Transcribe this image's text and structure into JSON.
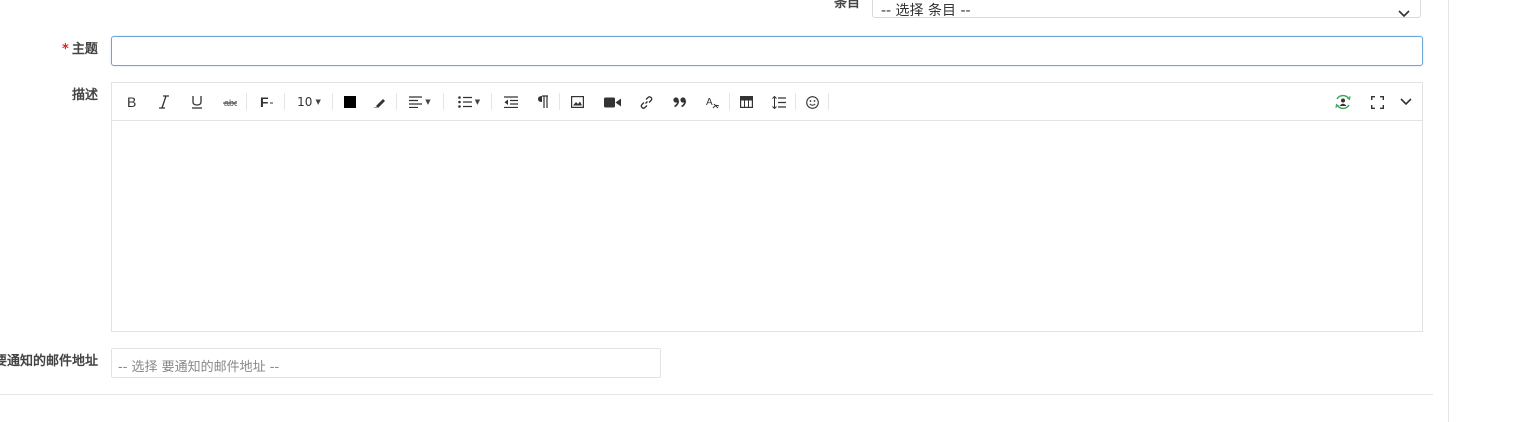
{
  "category": {
    "label": "条目",
    "placeholder": "-- 选择 条目 --"
  },
  "subject": {
    "required_mark": "*",
    "label": "主题",
    "value": ""
  },
  "description": {
    "label": "描述",
    "toolbar": {
      "font_size": "10",
      "icons": [
        "bold-icon",
        "italic-icon",
        "underline-icon",
        "strikethrough-icon",
        "font-family-icon",
        "font-size-dropdown",
        "text-color-icon",
        "highlight-icon",
        "align-icon",
        "list-icon",
        "outdent-icon",
        "paragraph-icon",
        "image-icon",
        "video-icon",
        "link-icon",
        "quote-icon",
        "clear-format-icon",
        "table-icon",
        "line-height-icon",
        "emoji-icon",
        "preview-icon",
        "fullscreen-icon",
        "more-icon"
      ]
    },
    "accent_color": "#3aa55d"
  },
  "notify": {
    "label": "要通知的邮件地址",
    "placeholder": "-- 选择 要通知的邮件地址 --"
  }
}
